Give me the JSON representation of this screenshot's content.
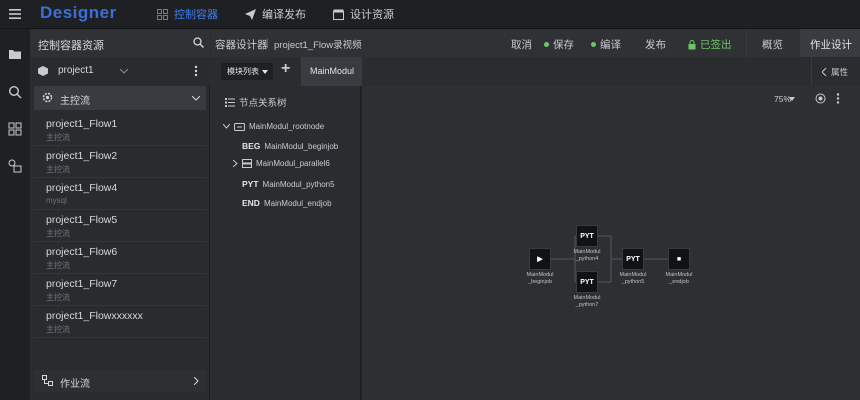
{
  "app": {
    "logo": "Designer"
  },
  "topnav": [
    {
      "label": "控制容器",
      "icon": "grid-icon"
    },
    {
      "label": "编译发布",
      "icon": "paper-plane-icon"
    },
    {
      "label": "设计资源",
      "icon": "box-icon"
    }
  ],
  "resources": {
    "title": "控制容器资源",
    "project": "project1",
    "group": "主控流",
    "flows": [
      {
        "name": "project1_Flow1",
        "sub": "主控流"
      },
      {
        "name": "project1_Flow2",
        "sub": "主控流"
      },
      {
        "name": "project1_Flow4",
        "sub": "mysql"
      },
      {
        "name": "project1_Flow5",
        "sub": "主控流"
      },
      {
        "name": "project1_Flow6",
        "sub": "主控流"
      },
      {
        "name": "project1_Flow7",
        "sub": "主控流"
      },
      {
        "name": "project1_Flowxxxxxx",
        "sub": "主控流"
      }
    ],
    "bottom_group": "作业流"
  },
  "designer": {
    "breadcrumb_root": "容器设计器",
    "breadcrumb_sep": "|",
    "breadcrumb_file": "project1_Flow录视频",
    "actions": {
      "cancel": "取消",
      "save": "保存",
      "compile": "编译",
      "publish": "发布",
      "checked_out": "已签出",
      "overview": "概览",
      "job_design": "作业设计"
    },
    "module_list": "模块列表",
    "add": "+",
    "tab": "MainModul",
    "properties": "属性",
    "tree_title": "节点关系树",
    "tree": {
      "root": "MainModul_rootnode",
      "items": [
        {
          "tag": "BEG",
          "name": "MainModul_beginjob"
        },
        {
          "tag": "",
          "name": "MainModul_parallel6"
        },
        {
          "tag": "PYT",
          "name": "MainModul_python5"
        },
        {
          "tag": "END",
          "name": "MainModul_endjob"
        }
      ]
    },
    "zoom": "75%",
    "graph": {
      "begin": {
        "icon": "▶",
        "label1": "MainModul",
        "label2": "_beginjob"
      },
      "python4": {
        "icon": "PYT",
        "label1": "MainModul",
        "label2": "_python4"
      },
      "python7": {
        "icon": "PYT",
        "label1": "MainModul",
        "label2": "_python7"
      },
      "python5": {
        "icon": "PYT",
        "label1": "MainModul",
        "label2": "_python5"
      },
      "end": {
        "icon": "■",
        "label1": "MainModul",
        "label2": "_endjob"
      }
    }
  },
  "colors": {
    "accent": "#3f7ef0",
    "success": "#6fc36a",
    "bg": "#2b2c30"
  }
}
